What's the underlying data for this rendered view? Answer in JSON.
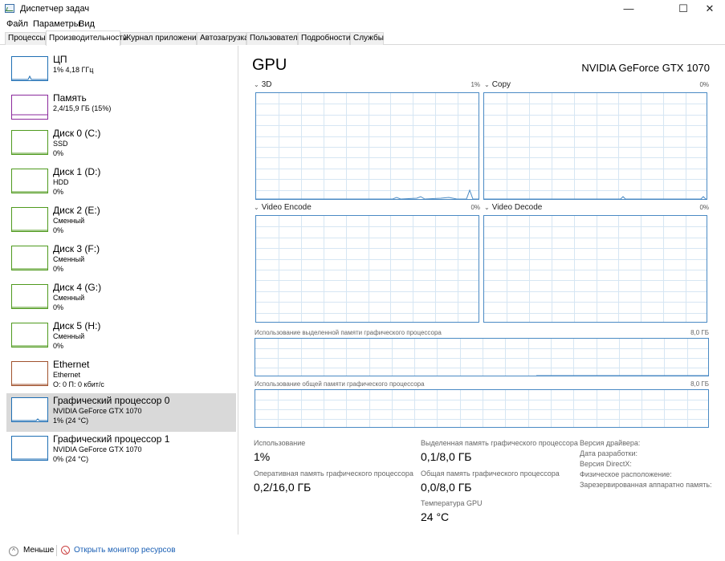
{
  "window": {
    "title": "Диспетчер задач",
    "minimize": "—",
    "maximize": "☐",
    "close": "✕"
  },
  "menu": [
    "Файл",
    "Параметры",
    "Вид"
  ],
  "tabs": [
    "Процессы",
    "Производительность",
    "Журнал приложений",
    "Автозагрузка",
    "Пользователи",
    "Подробности",
    "Службы"
  ],
  "active_tab": "Производительность",
  "sidebar": [
    {
      "name": "ЦП",
      "sub": "1% 4,18 ГГц",
      "val": "",
      "color": "#1f6fb4"
    },
    {
      "name": "Память",
      "sub": "2,4/15,9 ГБ (15%)",
      "val": "",
      "color": "#8b2a9c"
    },
    {
      "name": "Диск 0 (C:)",
      "sub": "SSD",
      "val": "0%",
      "color": "#4f9a1e"
    },
    {
      "name": "Диск 1 (D:)",
      "sub": "HDD",
      "val": "0%",
      "color": "#4f9a1e"
    },
    {
      "name": "Диск 2 (E:)",
      "sub": "Сменный",
      "val": "0%",
      "color": "#4f9a1e"
    },
    {
      "name": "Диск 3 (F:)",
      "sub": "Сменный",
      "val": "0%",
      "color": "#4f9a1e"
    },
    {
      "name": "Диск 4 (G:)",
      "sub": "Сменный",
      "val": "0%",
      "color": "#4f9a1e"
    },
    {
      "name": "Диск 5 (H:)",
      "sub": "Сменный",
      "val": "0%",
      "color": "#4f9a1e"
    },
    {
      "name": "Ethernet",
      "sub": "Ethernet",
      "val": "О: 0 П: 0 кбит/с",
      "color": "#a0522d"
    },
    {
      "name": "Графический процессор 0",
      "sub": "NVIDIA GeForce GTX 1070",
      "val": "1% (24 °C)",
      "color": "#1f6fb4",
      "selected": true
    },
    {
      "name": "Графический процессор 1",
      "sub": "NVIDIA GeForce GTX 1070",
      "val": "0% (24 °C)",
      "color": "#1f6fb4"
    }
  ],
  "main": {
    "title": "GPU",
    "model": "NVIDIA GeForce GTX 1070",
    "engines": [
      {
        "label": "3D",
        "pct": "1%"
      },
      {
        "label": "Copy",
        "pct": "0%"
      },
      {
        "label": "Video Encode",
        "pct": "0%"
      },
      {
        "label": "Video Decode",
        "pct": "0%"
      }
    ],
    "dedicated_label": "Использование выделенной памяти графического процессора",
    "dedicated_max": "8,0 ГБ",
    "shared_label": "Использование общей памяти графического процессора",
    "shared_max": "8,0 ГБ",
    "stats": {
      "usage_label": "Использование",
      "usage_value": "1%",
      "dedicated_label": "Выделенная память графического процессора",
      "dedicated_value": "0,1/8,0 ГБ",
      "ram_label": "Оперативная память графического процессора",
      "ram_value": "0,2/16,0 ГБ",
      "shared_label": "Общая память графического процессора",
      "shared_value": "0,0/8,0 ГБ",
      "temp_label": "Температура GPU",
      "temp_value": "24 °C"
    },
    "info": [
      "Версия драйвера:",
      "Дата разработки:",
      "Версия DirectX:",
      "Физическое расположение:",
      "Зарезервированная аппаратно память:"
    ]
  },
  "footer": {
    "fewer": "Меньше",
    "monitor": "Открыть монитор ресурсов"
  },
  "colors": {
    "accent": "#4a8ac4",
    "grid": "#d6e6f3",
    "selected": "#d9d9d9"
  }
}
